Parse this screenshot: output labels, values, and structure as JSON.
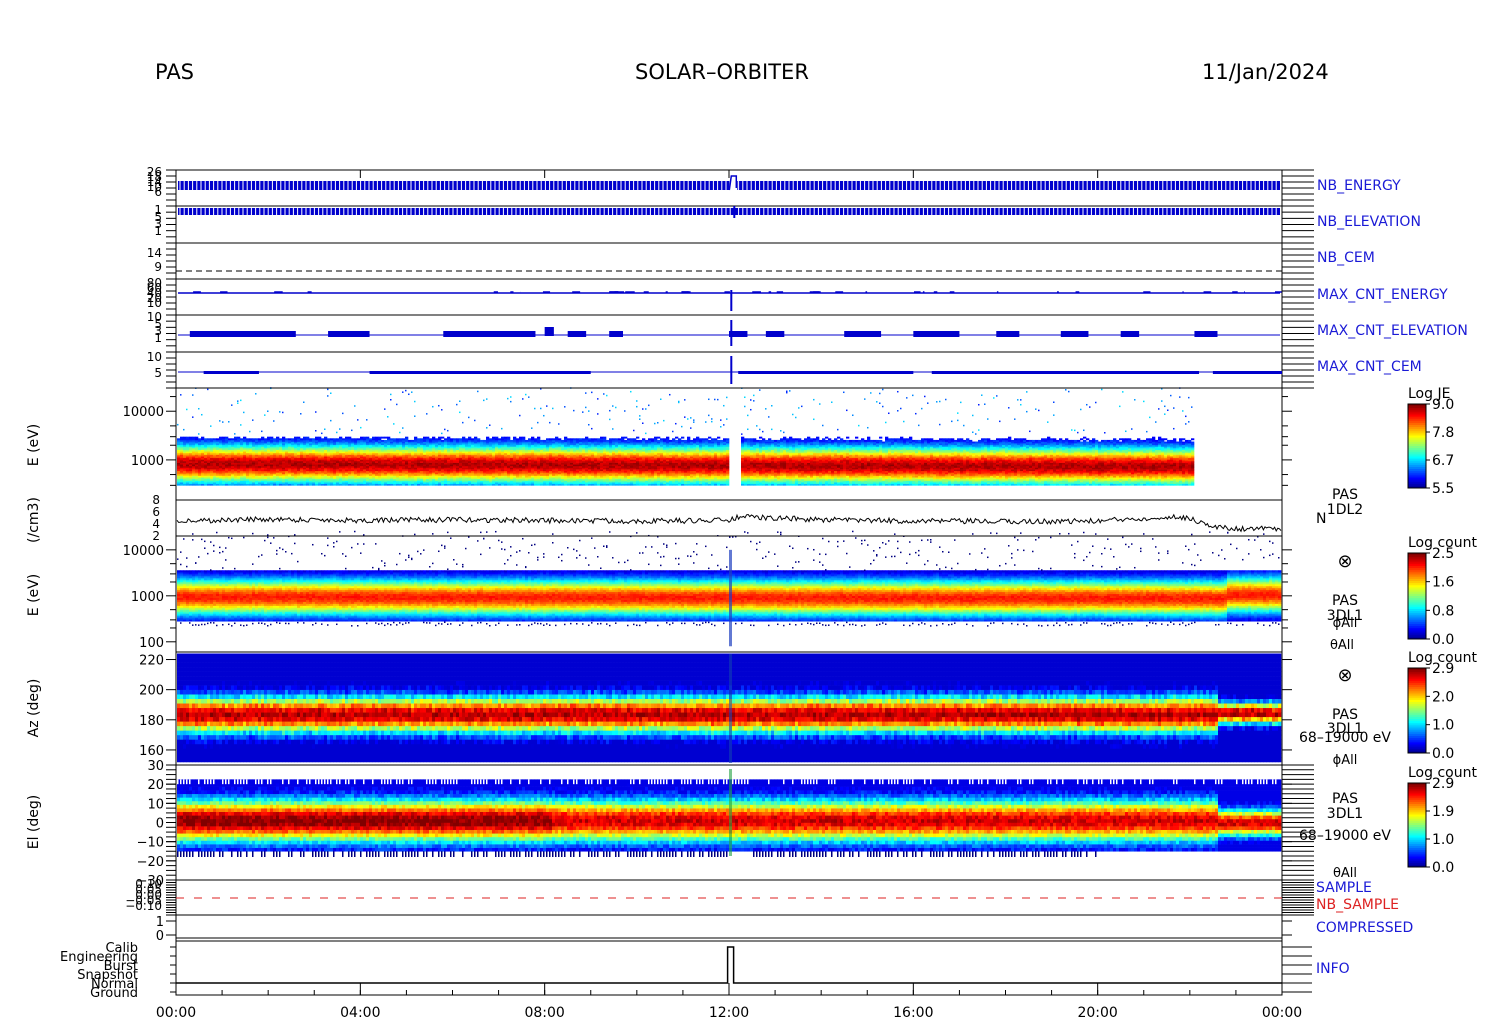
{
  "header": {
    "left": "PAS",
    "center": "SOLAR–ORBITER",
    "right": "11/Jan/2024"
  },
  "colors": {
    "trace_blue": "#0000cc",
    "nb_sample_red": "#dd2222",
    "label_blue": "#1a1ad6"
  },
  "chart_data": {
    "type": "heatmap",
    "x_axis": {
      "ticks": [
        "00:00",
        "04:00",
        "08:00",
        "12:00",
        "16:00",
        "20:00",
        "00:00"
      ],
      "range_hours": [
        0,
        24
      ]
    },
    "panels": [
      {
        "id": "nb-energy",
        "type": "line",
        "right_label": "NB_ENERGY",
        "pattern": "dense-square-wave",
        "step_hour": 12.05
      },
      {
        "id": "nb-elevation",
        "type": "line",
        "right_label": "NB_ELEVATION",
        "pattern": "dense-square-wave",
        "step_hour": 12.05
      },
      {
        "id": "nb-cem",
        "type": "line",
        "right_label": "NB_CEM",
        "ticks": [
          "14",
          "9"
        ],
        "pattern": "dashed-constant"
      },
      {
        "id": "max-cnt-energy",
        "type": "line",
        "right_label": "MAX_CNT_ENERGY"
      },
      {
        "id": "max-cnt-elevation",
        "type": "line",
        "right_label": "MAX_CNT_ELEVATION"
      },
      {
        "id": "max-cnt-cem",
        "type": "line",
        "right_label": "MAX_CNT_CEM",
        "ticks": [
          "10",
          "5"
        ]
      },
      {
        "id": "energy-spectrogram",
        "type": "heatmap",
        "ylabel": "E (eV)",
        "y_scale": "log",
        "y_ticks": [
          "10000",
          "1000"
        ],
        "y_range": [
          150,
          30000
        ],
        "colorbar": {
          "title": "Log JE",
          "ticks": [
            "9.0",
            "7.8",
            "6.7",
            "5.5"
          ],
          "range": [
            5.5,
            9.0
          ]
        },
        "data_end_hour": 22.05,
        "peak_energy_ev": 800,
        "gap_hour": 12.1
      },
      {
        "id": "density",
        "type": "line",
        "ylabel": "(/cm3)",
        "y_ticks": [
          "8",
          "6",
          "4",
          "2"
        ],
        "y_range": [
          2,
          8
        ],
        "right_labels": [
          "PAS",
          "1DL2",
          "N"
        ],
        "series": [
          {
            "x": [
              0,
              2,
              4,
              6,
              8,
              10,
              12,
              12.2,
              14,
              16,
              18,
              20,
              21.5,
              22,
              22.5,
              23,
              24
            ],
            "y": [
              4.5,
              4.8,
              4.6,
              4.7,
              4.6,
              4.5,
              4.6,
              5.2,
              4.7,
              4.5,
              4.4,
              4.5,
              5.2,
              5.0,
              3.5,
              3.2,
              3.3
            ]
          }
        ]
      },
      {
        "id": "energy-3d",
        "type": "heatmap",
        "ylabel": "E (eV)",
        "y_scale": "log",
        "y_ticks": [
          "10000",
          "1000",
          "100"
        ],
        "y_range": [
          60,
          20000
        ],
        "right_labels": [
          "⊗",
          "PAS",
          "3DL1",
          "ϕAll",
          "θAll"
        ],
        "colorbar": {
          "title": "Log count",
          "ticks": [
            "2.5",
            "1.6",
            "0.8",
            "0.0"
          ],
          "range": [
            0.0,
            2.5
          ]
        },
        "peak_energy_ev": 900
      },
      {
        "id": "azimuth",
        "type": "heatmap",
        "ylabel": "Az (deg)",
        "y_ticks": [
          "220",
          "200",
          "180",
          "160"
        ],
        "y_range": [
          150,
          225
        ],
        "right_labels": [
          "⊗",
          "PAS",
          "3DL1",
          "68–19000 eV",
          "ϕAll"
        ],
        "colorbar": {
          "title": "Log count",
          "ticks": [
            "2.9",
            "2.0",
            "1.0",
            "0.0"
          ],
          "range": [
            0.0,
            2.9
          ]
        },
        "peak_deg": 182,
        "shift_hour": 22.6,
        "shift_peak_deg": 183
      },
      {
        "id": "elevation",
        "type": "heatmap",
        "ylabel": "El (deg)",
        "y_ticks": [
          "30",
          "20",
          "10",
          "0",
          "−10",
          "−20",
          "−30"
        ],
        "y_range": [
          -30,
          30
        ],
        "right_labels": [
          "PAS",
          "3DL1",
          "68–19000 eV",
          "θAll"
        ],
        "colorbar": {
          "title": "Log count",
          "ticks": [
            "2.9",
            "1.9",
            "1.0",
            "0.0"
          ],
          "range": [
            0.0,
            2.9
          ]
        },
        "peak_deg": 0
      },
      {
        "id": "sample",
        "type": "line",
        "right_labels": [
          "SAMPLE",
          "NB_SAMPLE"
        ],
        "y_ticks": [
          "0.10",
          "0.05",
          "0.00",
          "−0.05",
          "−0.10"
        ]
      },
      {
        "id": "compressed",
        "type": "line",
        "right_label": "COMPRESSED",
        "y_ticks": [
          "1",
          "0"
        ]
      },
      {
        "id": "info",
        "type": "line",
        "right_label": "INFO",
        "y_ticks": [
          "Calib",
          "Engineering",
          "Burst",
          "Snapshot",
          "Normal",
          "Ground"
        ],
        "step_hour": 12.1
      }
    ]
  }
}
